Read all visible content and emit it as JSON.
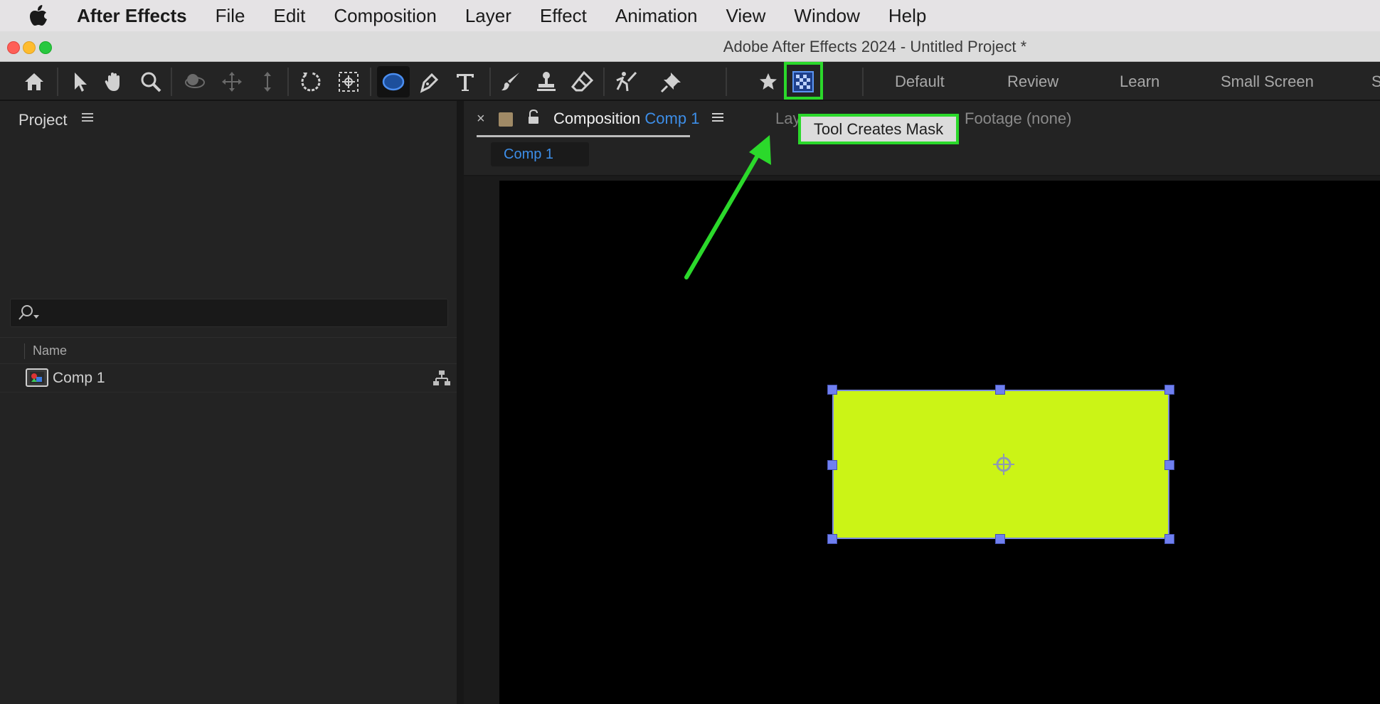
{
  "menubar": {
    "app_name": "After Effects",
    "items": [
      "File",
      "Edit",
      "Composition",
      "Layer",
      "Effect",
      "Animation",
      "View",
      "Window",
      "Help"
    ]
  },
  "window": {
    "title": "Adobe After Effects 2024 - Untitled Project *"
  },
  "toolbar": {
    "tools": [
      "home-icon",
      "selection-tool-icon",
      "hand-tool-icon",
      "zoom-tool-icon",
      "orbit-camera-icon",
      "pan-camera-icon",
      "dolly-camera-icon",
      "rotation-tool-icon",
      "pan-behind-tool-icon",
      "ellipse-tool-icon",
      "pen-tool-icon",
      "type-tool-icon",
      "brush-tool-icon",
      "clone-stamp-icon",
      "eraser-tool-icon",
      "roto-brush-icon",
      "puppet-pin-icon",
      "star-icon",
      "tool-creates-mask-icon"
    ],
    "workspaces": [
      "Default",
      "Review",
      "Learn",
      "Small Screen",
      "S"
    ]
  },
  "project": {
    "title": "Project",
    "column_name": "Name",
    "items": [
      {
        "name": "Comp 1"
      }
    ]
  },
  "composition": {
    "close": "×",
    "tab_prefix": "Composition",
    "tab_comp": "Comp 1",
    "layer_tab": "Lay",
    "footage_tab": "Footage (none)",
    "subtab": "Comp 1"
  },
  "tooltip": {
    "text": "Tool Creates Mask"
  },
  "colors": {
    "shape_fill": "#cbf416",
    "highlight": "#2bd92b",
    "accent_blue": "#3d8ee8"
  }
}
